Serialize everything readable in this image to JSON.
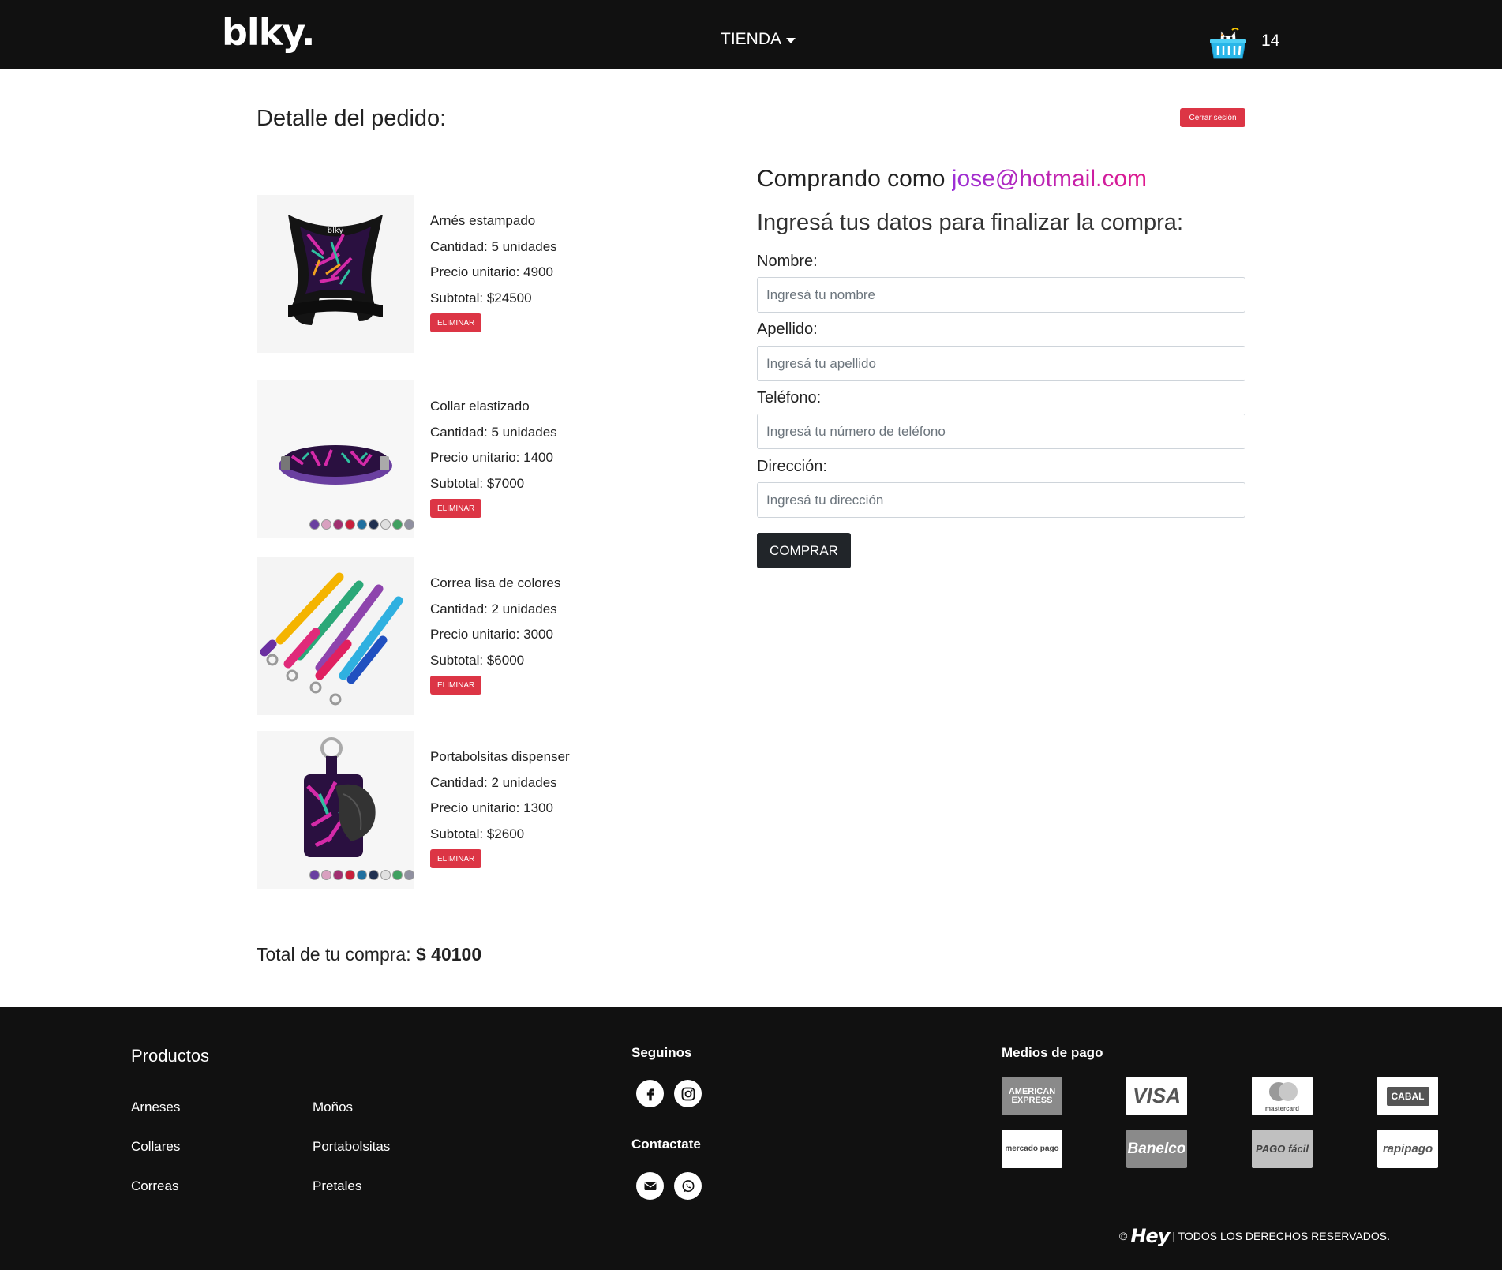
{
  "navbar": {
    "logo": "blky.",
    "tienda_label": "TIENDA",
    "cart_count": "14"
  },
  "order": {
    "title": "Detalle del pedido:",
    "logout_label": "Cerrar sesión",
    "items": [
      {
        "name": "Arnés estampado",
        "qty": "Cantidad: 5 unidades",
        "unit": "Precio unitario: 4900",
        "subtotal": "Subtotal: $24500",
        "delete": "ELIMINAR",
        "image": "harness-photo"
      },
      {
        "name": "Collar elastizado",
        "qty": "Cantidad: 5 unidades",
        "unit": "Precio unitario: 1400",
        "subtotal": "Subtotal: $7000",
        "delete": "ELIMINAR",
        "image": "collar-photo"
      },
      {
        "name": "Correa lisa de colores",
        "qty": "Cantidad: 2 unidades",
        "unit": "Precio unitario: 3000",
        "subtotal": "Subtotal: $6000",
        "delete": "ELIMINAR",
        "image": "leash-photo"
      },
      {
        "name": "Portabolsitas dispenser",
        "qty": "Cantidad: 2 unidades",
        "unit": "Precio unitario: 1300",
        "subtotal": "Subtotal: $2600",
        "delete": "ELIMINAR",
        "image": "bag-dispenser-photo"
      }
    ],
    "total_label": "Total de tu compra: ",
    "total_value": "$ 40100"
  },
  "checkout": {
    "buying_as_label": "Comprando como ",
    "email": "jose@hotmail.com",
    "form_title": "Ingresá tus datos para finalizar la compra:",
    "fields": [
      {
        "label": "Nombre:",
        "placeholder": "Ingresá tu nombre",
        "value": ""
      },
      {
        "label": "Apellido:",
        "placeholder": "Ingresá tu apellido",
        "value": ""
      },
      {
        "label": "Teléfono:",
        "placeholder": "Ingresá tu número de teléfono",
        "value": ""
      },
      {
        "label": "Dirección:",
        "placeholder": "Ingresá tu dirección",
        "value": ""
      }
    ],
    "buy_label": "COMPRAR"
  },
  "footer": {
    "products_title": "Productos",
    "products": [
      "Arneses",
      "Moños",
      "Collares",
      "Portabolsitas",
      "Correas",
      "Pretales"
    ],
    "follow_title": "Seguinos",
    "contact_title": "Contactate",
    "payments_title": "Medios de pago",
    "payments": [
      "AMERICAN EXPRESS",
      "VISA",
      "mastercard",
      "CABAL",
      "mercado pago",
      "Banelco",
      "PAGO fácil",
      "rapipago"
    ],
    "copyright_brand": "Hey",
    "copyright_text": "| TODOS LOS DERECHOS RESERVADOS."
  },
  "colors": {
    "navbar_bg": "#111111",
    "danger": "#dc3545",
    "button_dark": "#212529",
    "email_gradient_start": "#9b2fd6",
    "email_gradient_end": "#e0188d"
  }
}
